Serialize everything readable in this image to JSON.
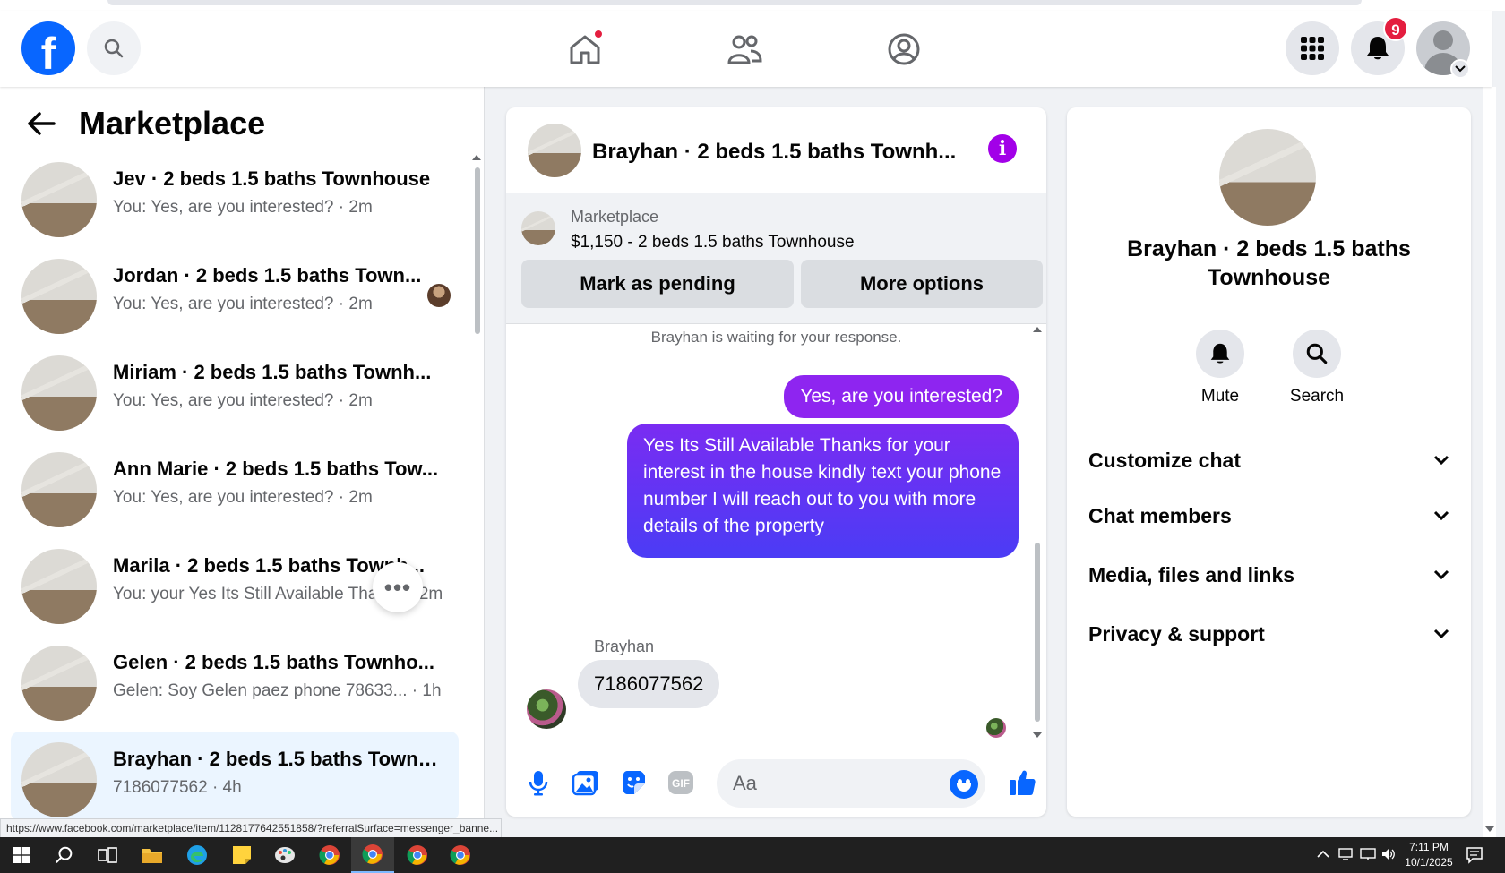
{
  "topnav": {
    "logo": "f",
    "notification_count": "9"
  },
  "sidebar": {
    "title": "Marketplace",
    "conversations": [
      {
        "name": "Jev · 2 beds 1.5 baths Townhouse",
        "preview": "You: Yes, are you interested? · 2m"
      },
      {
        "name": "Jordan · 2 beds 1.5 baths Town...",
        "preview": "You: Yes, are you interested? · 2m"
      },
      {
        "name": "Miriam · 2 beds 1.5 baths Townh...",
        "preview": "You: Yes, are you interested? · 2m"
      },
      {
        "name": "Ann Marie · 2 beds 1.5 baths Tow...",
        "preview": "You: Yes, are you interested? · 2m"
      },
      {
        "name": "Marila · 2 beds 1.5 baths Townh...",
        "preview": "You: your Yes Its Still Available Thanks · 2m"
      },
      {
        "name": "Gelen · 2 beds 1.5 baths Townho...",
        "preview": "Gelen: Soy Gelen paez phone 78633... · 1h"
      },
      {
        "name": "Brayhan · 2 beds 1.5 baths Townh...",
        "preview": "7186077562 · 4h"
      }
    ],
    "more_label": "•••"
  },
  "status_url": "https://www.facebook.com/marketplace/item/1128177642551858/?referralSurface=messenger_banne...",
  "chat": {
    "title": "Brayhan · 2 beds 1.5 baths Townh...",
    "info_label": "i",
    "listing": {
      "source": "Marketplace",
      "price_title": "$1,150 - 2 beds 1.5 baths Townhouse",
      "mark_pending": "Mark as pending",
      "more_options": "More options"
    },
    "waiting": "Brayhan is waiting for your response.",
    "messages": {
      "out1": "Yes, are you interested?",
      "out2": "Yes Its Still Available Thanks for your interest in the house kindly text your phone number I will reach out to you with more details of the property",
      "sender": "Brayhan",
      "in1": "7186077562"
    },
    "composer": {
      "placeholder": "Aa"
    }
  },
  "info_panel": {
    "title": "Brayhan · 2 beds 1.5 baths Townhouse",
    "mute": "Mute",
    "search": "Search",
    "sections": [
      "Customize chat",
      "Chat members",
      "Media, files and links",
      "Privacy & support"
    ]
  },
  "taskbar": {
    "time": "7:11 PM",
    "date": "10/1/2025"
  },
  "colors": {
    "brand": "#0866ff",
    "outgoing_bubble": "#8e25f0",
    "notification": "#e41e3f"
  }
}
